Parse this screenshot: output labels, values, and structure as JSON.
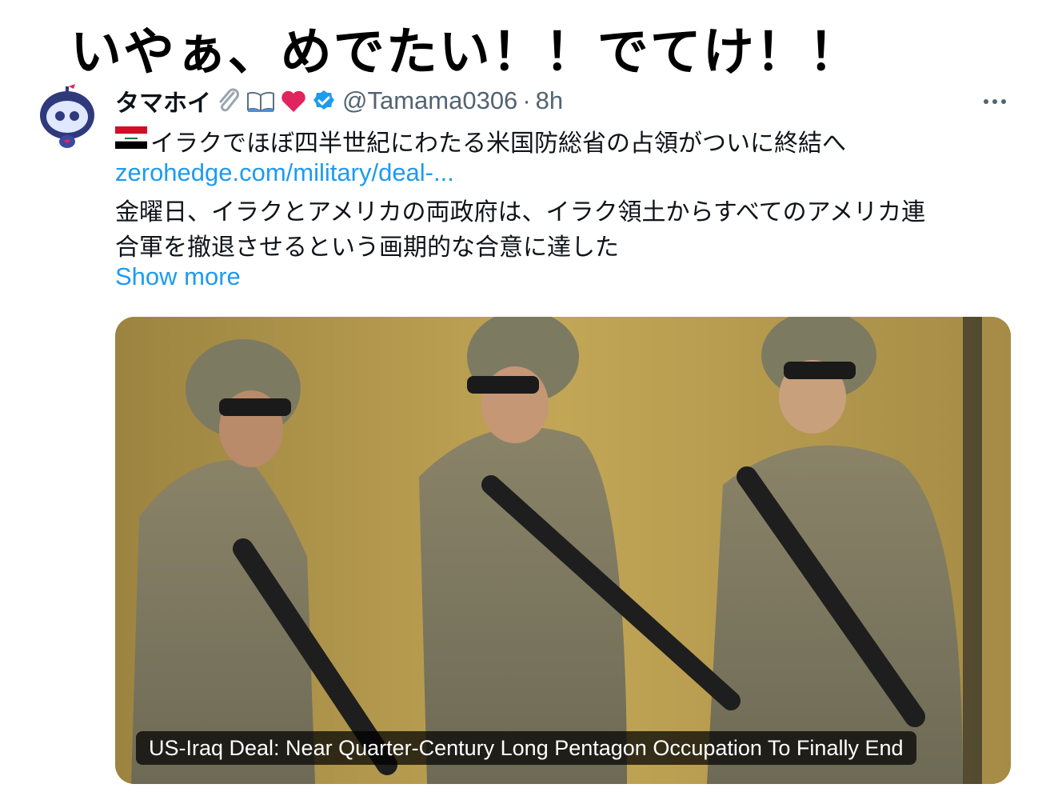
{
  "caption": "いやぁ、めでたい！！でてけ！！",
  "tweet": {
    "display_name": "タマホイ",
    "name_emojis": [
      "paperclip-icon",
      "book-icon",
      "red-heart-icon"
    ],
    "verified": true,
    "handle": "@Tamama0306",
    "separator": "·",
    "time": "8h",
    "flag": "iraq-flag-icon",
    "headline": "イラクでほぼ四半世紀にわたる米国防総省の占領がついに終結へ",
    "link": "zerohedge.com/military/deal-...",
    "body_line1": "金曜日、イラクとアメリカの両政府は、イラク領土からすべてのアメリカ連",
    "body_line2": "合軍を撤退させるという画期的な合意に達した",
    "show_more": "Show more",
    "card": {
      "title": "US-Iraq Deal: Near Quarter-Century Long Pentagon Occupation To Finally End"
    }
  },
  "colors": {
    "link": "#1d9bf0",
    "muted": "#536471",
    "verified": "#1d9bf0",
    "heart": "#e0245e"
  }
}
